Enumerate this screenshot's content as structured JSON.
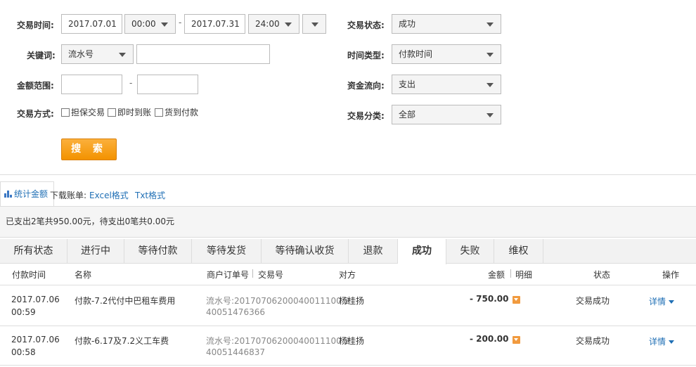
{
  "filters": {
    "trade_time": {
      "label": "交易时间:",
      "start_date": "2017.07.01",
      "start_time": "00:00",
      "separator": "-",
      "end_date": "2017.07.31",
      "end_time": "24:00"
    },
    "keyword": {
      "label": "关键词:",
      "type_value": "流水号",
      "value": ""
    },
    "amount_range": {
      "label": "金额范围:",
      "min": "",
      "separator": "-",
      "max": ""
    },
    "trade_method": {
      "label": "交易方式:",
      "options": [
        "担保交易",
        "即时到账",
        "货到付款"
      ]
    },
    "trade_status": {
      "label": "交易状态:",
      "value": "成功"
    },
    "time_type": {
      "label": "时间类型:",
      "value": "付款时间"
    },
    "fund_flow": {
      "label": "资金流向:",
      "value": "支出"
    },
    "trade_category": {
      "label": "交易分类:",
      "value": "全部"
    },
    "search_button": "搜 索"
  },
  "toolbar": {
    "stat_tab": "统计金额",
    "download_label": "下载账单:",
    "excel_link": "Excel格式",
    "txt_link": "Txt格式"
  },
  "summary": "已支出2笔共950.00元，待支出0笔共0.00元",
  "status_tabs": [
    "所有状态",
    "进行中",
    "等待付款",
    "等待发货",
    "等待确认收货",
    "退款",
    "成功",
    "失败",
    "维权"
  ],
  "active_tab": "成功",
  "table": {
    "headers": {
      "pay_time": "付款时间",
      "name": "名称",
      "order_no": "商户订单号",
      "trade_no": "交易号",
      "counterparty": "对方",
      "amount": "金额",
      "detail": "明细",
      "status": "状态",
      "action": "操作"
    },
    "rows": [
      {
        "date": "2017.07.06",
        "time": "00:59",
        "name": "付款-7.2代付中巴租车费用",
        "serial_line1": "流水号:20170706200040011100 2",
        "serial_line2": "40051476366",
        "counterparty": "杨桂扬",
        "amount": "- 750.00",
        "status": "交易成功",
        "action": "详情"
      },
      {
        "date": "2017.07.06",
        "time": "00:58",
        "name": "付款-6.17及7.2义工车费",
        "serial_line1": "流水号:20170706200040011100 2",
        "serial_line2": "40051446837",
        "counterparty": "杨桂扬",
        "amount": "- 200.00",
        "status": "交易成功",
        "action": "详情"
      }
    ]
  },
  "colors": {
    "accent_orange": "#f39200",
    "link_blue": "#1f6fb5",
    "border": "#dddddd",
    "summary_bg": "#f5f5f5"
  },
  "icons": {
    "select_arrow": "chevron-down-icon",
    "stat_icon": "bar-chart-icon",
    "detail_icon": "dropdown-square-icon"
  }
}
